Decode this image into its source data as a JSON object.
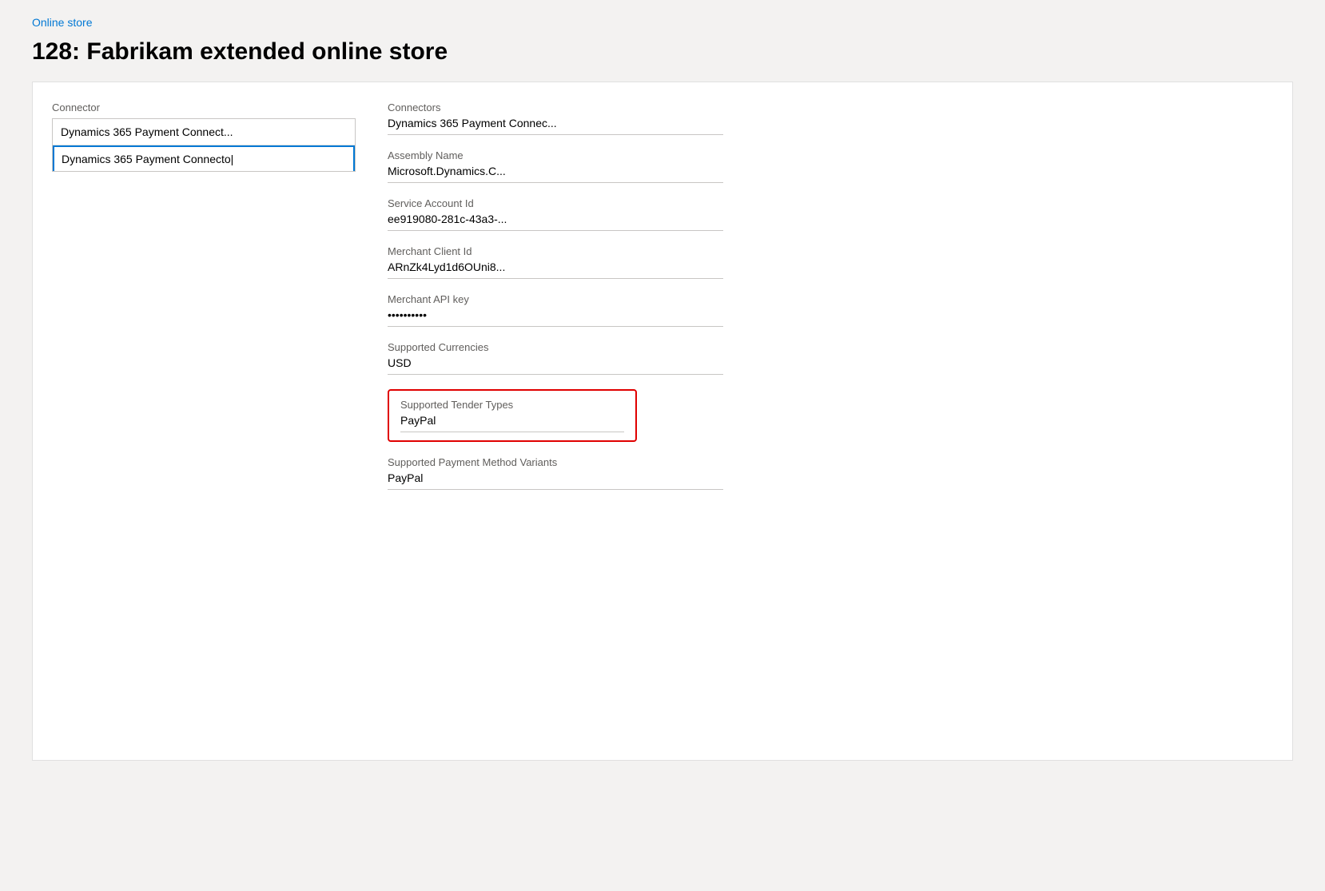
{
  "breadcrumb": {
    "label": "Online store",
    "link": "#"
  },
  "page": {
    "title": "128: Fabrikam extended online store"
  },
  "left_panel": {
    "section_label": "Connector",
    "items": [
      {
        "text": "Dynamics 365 Payment Connect...",
        "selected": false
      },
      {
        "text": "Dynamics 365 Payment Connecto|",
        "selected": true
      }
    ]
  },
  "right_panel": {
    "fields": [
      {
        "id": "connectors",
        "label": "Connectors",
        "value": "Dynamics 365 Payment Connec...",
        "highlighted": false
      },
      {
        "id": "assembly-name",
        "label": "Assembly Name",
        "value": "Microsoft.Dynamics.C...",
        "highlighted": false
      },
      {
        "id": "service-account-id",
        "label": "Service Account Id",
        "value": "ee919080-281c-43a3-...",
        "highlighted": false
      },
      {
        "id": "merchant-client-id",
        "label": "Merchant Client Id",
        "value": "ARnZk4Lyd1d6OUni8...",
        "highlighted": false
      },
      {
        "id": "merchant-api-key",
        "label": "Merchant API key",
        "value": "••••••••••",
        "highlighted": false
      },
      {
        "id": "supported-currencies",
        "label": "Supported Currencies",
        "value": "USD",
        "highlighted": false
      },
      {
        "id": "supported-tender-types",
        "label": "Supported Tender Types",
        "value": "PayPal",
        "highlighted": true
      },
      {
        "id": "supported-payment-method-variants",
        "label": "Supported Payment Method Variants",
        "value": "PayPal",
        "highlighted": false
      }
    ]
  }
}
